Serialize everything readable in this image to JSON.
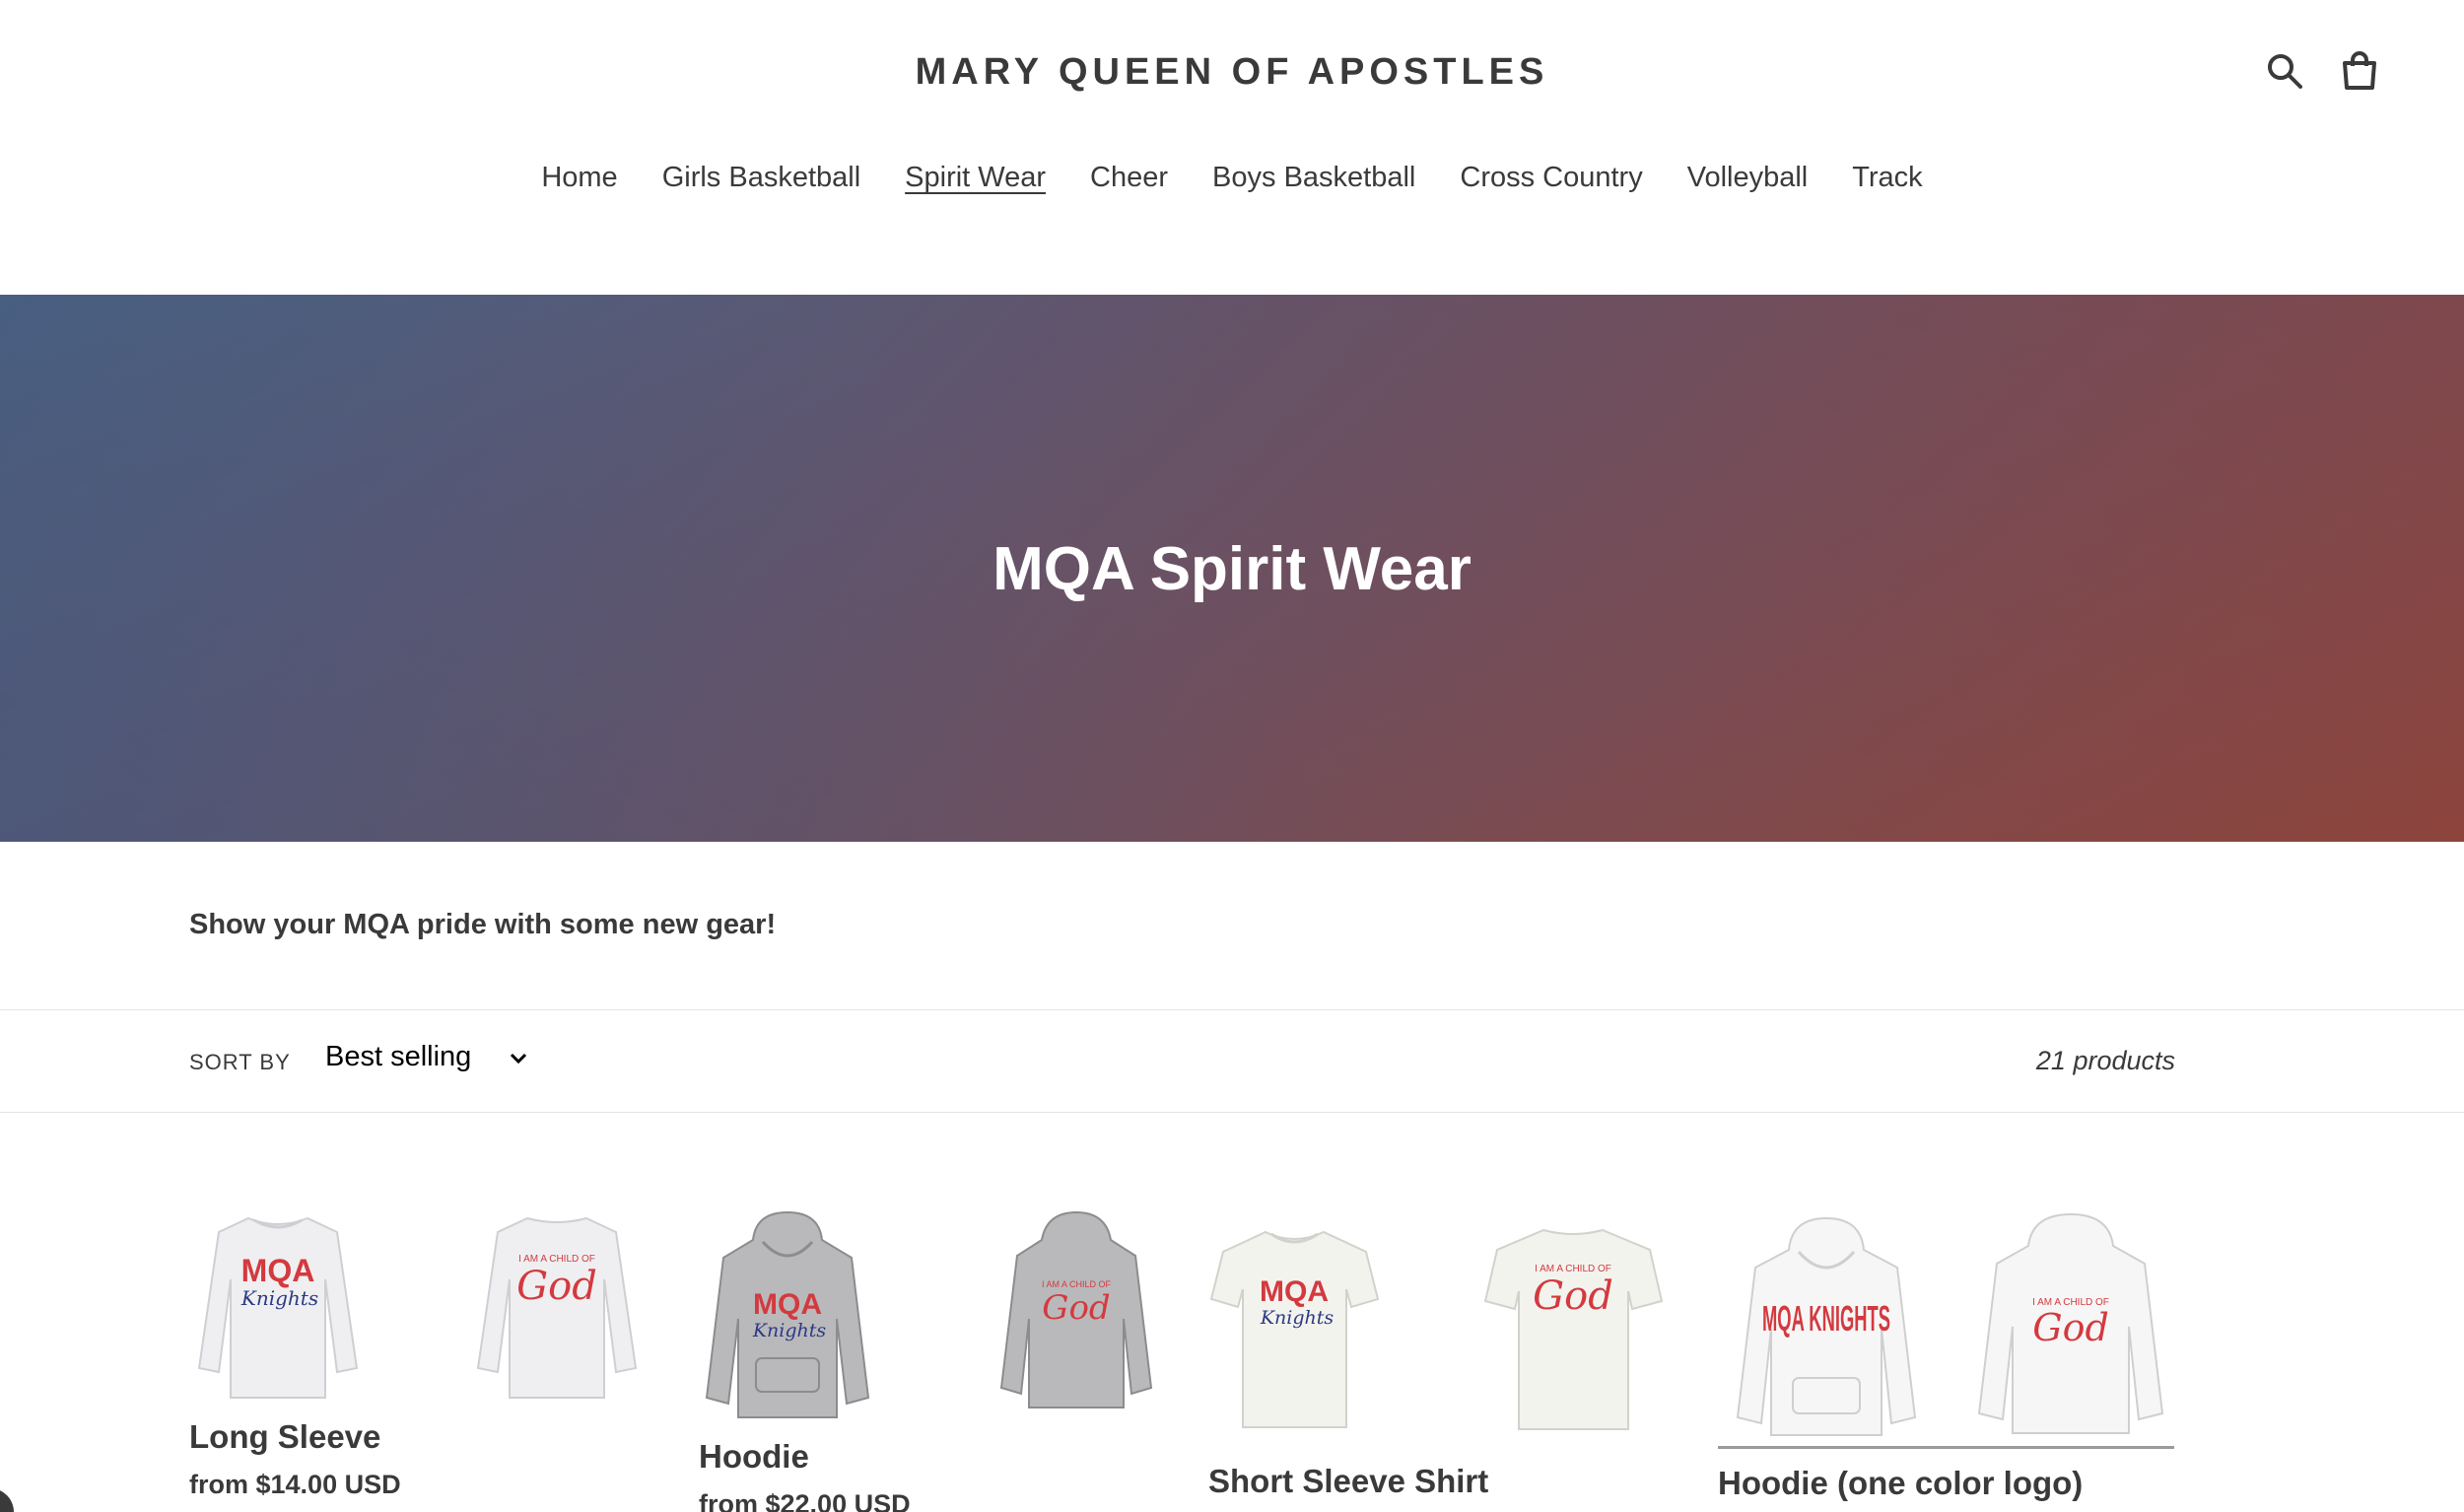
{
  "header": {
    "store_name": "MARY QUEEN OF APOSTLES",
    "icons": [
      "search-icon",
      "cart-icon"
    ]
  },
  "nav": {
    "items": [
      "Home",
      "Girls Basketball",
      "Spirit Wear",
      "Cheer",
      "Boys Basketball",
      "Cross Country",
      "Volleyball",
      "Track"
    ],
    "active": "Spirit Wear"
  },
  "hero": {
    "title": "MQA Spirit Wear"
  },
  "collection": {
    "description": "Show your MQA pride with some new gear!"
  },
  "filters": {
    "sort_label": "SORT BY",
    "sort_value": "Best selling",
    "product_count": "21 products"
  },
  "products": [
    {
      "title": "Long Sleeve",
      "price": "from $14.00 USD",
      "garment": "long-sleeve",
      "shirt_color": "#efeff1"
    },
    {
      "title": "Hoodie",
      "price": "from $22.00 USD",
      "garment": "hoodie",
      "shirt_color": "#b9b9bb"
    },
    {
      "title": "Short Sleeve Shirt",
      "price": "",
      "garment": "tee",
      "shirt_color": "#f3f3ee"
    },
    {
      "title": "Hoodie (one color logo)",
      "price": "",
      "garment": "hoodie",
      "shirt_color": "#f6f6f6"
    }
  ],
  "artwork": {
    "front_logo": "MQA",
    "front_script": "Knights",
    "front_logo_alt": "MQA KNIGHTS",
    "back_line1": "I AM A CHILD OF",
    "back_script": "God"
  },
  "colors": {
    "brand_red": "#d33a3f",
    "brand_navy": "#2c3a84",
    "text": "#3a3a3a"
  }
}
